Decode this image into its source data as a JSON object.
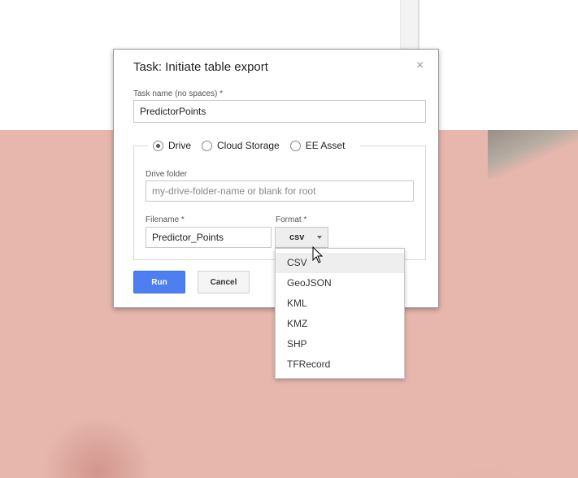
{
  "dialog": {
    "title": "Task: Initiate table export",
    "close_glyph": "×",
    "task_name_label": "Task name (no spaces) *",
    "task_name_value": "PredictorPoints",
    "destinations": [
      {
        "label": "Drive",
        "selected": true
      },
      {
        "label": "Cloud Storage",
        "selected": false
      },
      {
        "label": "EE Asset",
        "selected": false
      }
    ],
    "drive_folder_label": "Drive folder",
    "drive_folder_placeholder": "my-drive-folder-name or blank for root",
    "filename_label": "Filename *",
    "filename_value": "Predictor_Points",
    "format_label": "Format *",
    "format_value": "csv",
    "run_label": "Run",
    "cancel_label": "Cancel"
  },
  "format_menu": {
    "options": [
      "CSV",
      "GeoJSON",
      "KML",
      "KMZ",
      "SHP",
      "TFRecord"
    ],
    "highlighted": "CSV"
  },
  "colors": {
    "accent": "#4d7ff0",
    "map_background": "#e7b7ae"
  }
}
